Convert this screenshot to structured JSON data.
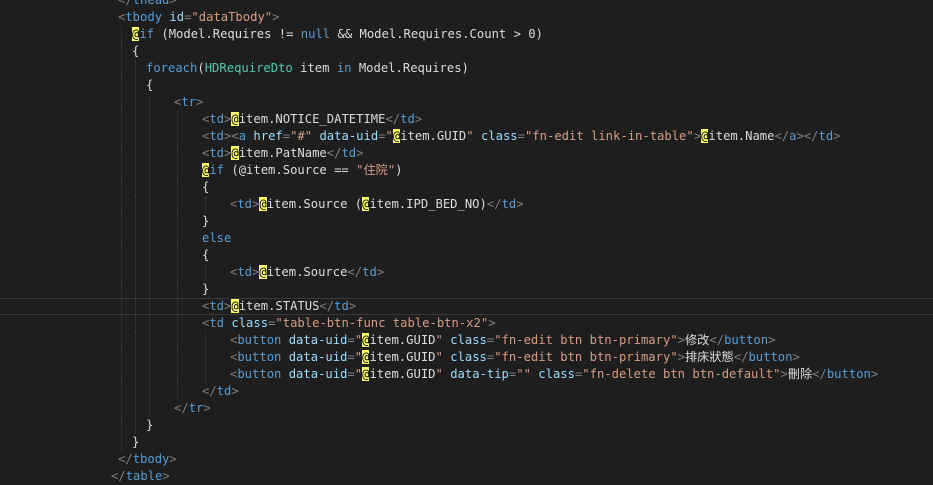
{
  "theme": {
    "background": "#1e1e1e",
    "punctuation": "#808080",
    "tag": "#569cd6",
    "attribute": "#9cdcfe",
    "string": "#d69d85",
    "text": "#dcdcdc",
    "razor_marker_bg": "#ffff66",
    "type": "#4ec9b0"
  },
  "editor": {
    "lines": [
      {
        "indent": 4,
        "tokens": [
          {
            "t": "pun",
            "v": "</"
          },
          {
            "t": "tag",
            "v": "thead"
          },
          {
            "t": "pun",
            "v": ">"
          }
        ]
      },
      {
        "indent": 4,
        "tokens": [
          {
            "t": "pun",
            "v": "<"
          },
          {
            "t": "tag",
            "v": "tbody"
          },
          {
            "t": "txt",
            "v": " "
          },
          {
            "t": "attr",
            "v": "id"
          },
          {
            "t": "pun",
            "v": "="
          },
          {
            "t": "str",
            "v": "\"dataTbody\""
          },
          {
            "t": "pun",
            "v": ">"
          }
        ]
      },
      {
        "indent": 6,
        "tokens": [
          {
            "t": "razor",
            "v": "@"
          },
          {
            "t": "kw",
            "v": "if"
          },
          {
            "t": "id",
            "v": " (Model.Requires != "
          },
          {
            "t": "kw",
            "v": "null"
          },
          {
            "t": "id",
            "v": " && Model.Requires.Count > 0)"
          }
        ]
      },
      {
        "indent": 6,
        "tokens": [
          {
            "t": "id",
            "v": "{"
          }
        ]
      },
      {
        "indent": 8,
        "tokens": [
          {
            "t": "kw",
            "v": "foreach"
          },
          {
            "t": "id",
            "v": "("
          },
          {
            "t": "type",
            "v": "HDRequireDto"
          },
          {
            "t": "id",
            "v": " item "
          },
          {
            "t": "kw",
            "v": "in"
          },
          {
            "t": "id",
            "v": " Model.Requires)"
          }
        ]
      },
      {
        "indent": 8,
        "tokens": [
          {
            "t": "id",
            "v": "{"
          }
        ]
      },
      {
        "indent": 12,
        "tokens": [
          {
            "t": "pun",
            "v": "<"
          },
          {
            "t": "tag",
            "v": "tr"
          },
          {
            "t": "pun",
            "v": ">"
          }
        ]
      },
      {
        "indent": 16,
        "tokens": [
          {
            "t": "pun",
            "v": "<"
          },
          {
            "t": "tag",
            "v": "td"
          },
          {
            "t": "pun",
            "v": ">"
          },
          {
            "t": "razor",
            "v": "@"
          },
          {
            "t": "id",
            "v": "item.NOTICE_DATETIME"
          },
          {
            "t": "pun",
            "v": "</"
          },
          {
            "t": "tag",
            "v": "td"
          },
          {
            "t": "pun",
            "v": ">"
          }
        ]
      },
      {
        "indent": 16,
        "tokens": [
          {
            "t": "pun",
            "v": "<"
          },
          {
            "t": "tag",
            "v": "td"
          },
          {
            "t": "pun",
            "v": "><"
          },
          {
            "t": "tag",
            "v": "a"
          },
          {
            "t": "txt",
            "v": " "
          },
          {
            "t": "attr",
            "v": "href"
          },
          {
            "t": "pun",
            "v": "="
          },
          {
            "t": "str",
            "v": "\"#\""
          },
          {
            "t": "txt",
            "v": " "
          },
          {
            "t": "attr",
            "v": "data-uid"
          },
          {
            "t": "pun",
            "v": "="
          },
          {
            "t": "str",
            "v": "\""
          },
          {
            "t": "razor",
            "v": "@"
          },
          {
            "t": "id",
            "v": "item.GUID"
          },
          {
            "t": "str",
            "v": "\""
          },
          {
            "t": "txt",
            "v": " "
          },
          {
            "t": "attr",
            "v": "class"
          },
          {
            "t": "pun",
            "v": "="
          },
          {
            "t": "str",
            "v": "\"fn-edit link-in-table\""
          },
          {
            "t": "pun",
            "v": ">"
          },
          {
            "t": "razor",
            "v": "@"
          },
          {
            "t": "id",
            "v": "item.Name"
          },
          {
            "t": "pun",
            "v": "</"
          },
          {
            "t": "tag",
            "v": "a"
          },
          {
            "t": "pun",
            "v": "></"
          },
          {
            "t": "tag",
            "v": "td"
          },
          {
            "t": "pun",
            "v": ">"
          }
        ]
      },
      {
        "indent": 16,
        "tokens": [
          {
            "t": "pun",
            "v": "<"
          },
          {
            "t": "tag",
            "v": "td"
          },
          {
            "t": "pun",
            "v": ">"
          },
          {
            "t": "razor",
            "v": "@"
          },
          {
            "t": "id",
            "v": "item.PatName"
          },
          {
            "t": "pun",
            "v": "</"
          },
          {
            "t": "tag",
            "v": "td"
          },
          {
            "t": "pun",
            "v": ">"
          }
        ]
      },
      {
        "indent": 16,
        "tokens": [
          {
            "t": "razor",
            "v": "@"
          },
          {
            "t": "kw",
            "v": "if"
          },
          {
            "t": "id",
            "v": " (@item.Source == "
          },
          {
            "t": "str",
            "v": "\"住院\""
          },
          {
            "t": "id",
            "v": ")"
          }
        ]
      },
      {
        "indent": 16,
        "tokens": [
          {
            "t": "id",
            "v": "{"
          }
        ]
      },
      {
        "indent": 20,
        "tokens": [
          {
            "t": "pun",
            "v": "<"
          },
          {
            "t": "tag",
            "v": "td"
          },
          {
            "t": "pun",
            "v": ">"
          },
          {
            "t": "razor",
            "v": "@"
          },
          {
            "t": "id",
            "v": "item.Source ("
          },
          {
            "t": "razor",
            "v": "@"
          },
          {
            "t": "id",
            "v": "item.IPD_BED_NO)"
          },
          {
            "t": "pun",
            "v": "</"
          },
          {
            "t": "tag",
            "v": "td"
          },
          {
            "t": "pun",
            "v": ">"
          }
        ]
      },
      {
        "indent": 16,
        "tokens": [
          {
            "t": "id",
            "v": "}"
          }
        ]
      },
      {
        "indent": 16,
        "tokens": [
          {
            "t": "kw",
            "v": "else"
          }
        ]
      },
      {
        "indent": 16,
        "tokens": [
          {
            "t": "id",
            "v": "{"
          }
        ]
      },
      {
        "indent": 20,
        "tokens": [
          {
            "t": "pun",
            "v": "<"
          },
          {
            "t": "tag",
            "v": "td"
          },
          {
            "t": "pun",
            "v": ">"
          },
          {
            "t": "razor",
            "v": "@"
          },
          {
            "t": "id",
            "v": "item.Source"
          },
          {
            "t": "pun",
            "v": "</"
          },
          {
            "t": "tag",
            "v": "td"
          },
          {
            "t": "pun",
            "v": ">"
          }
        ]
      },
      {
        "indent": 16,
        "tokens": [
          {
            "t": "id",
            "v": "}"
          }
        ]
      },
      {
        "indent": 16,
        "current": true,
        "tokens": [
          {
            "t": "pun",
            "v": "<"
          },
          {
            "t": "tag",
            "v": "td"
          },
          {
            "t": "pun",
            "v": ">"
          },
          {
            "t": "razor",
            "v": "@"
          },
          {
            "t": "id",
            "v": "item.STATUS"
          },
          {
            "t": "pun",
            "v": "</"
          },
          {
            "t": "tag",
            "v": "td"
          },
          {
            "t": "pun",
            "v": ">"
          }
        ]
      },
      {
        "indent": 16,
        "tokens": [
          {
            "t": "pun",
            "v": "<"
          },
          {
            "t": "tag",
            "v": "td"
          },
          {
            "t": "txt",
            "v": " "
          },
          {
            "t": "attr",
            "v": "class"
          },
          {
            "t": "pun",
            "v": "="
          },
          {
            "t": "str",
            "v": "\"table-btn-func table-btn-x2\""
          },
          {
            "t": "pun",
            "v": ">"
          }
        ]
      },
      {
        "indent": 20,
        "tokens": [
          {
            "t": "pun",
            "v": "<"
          },
          {
            "t": "tag",
            "v": "button"
          },
          {
            "t": "txt",
            "v": " "
          },
          {
            "t": "attr",
            "v": "data-uid"
          },
          {
            "t": "pun",
            "v": "="
          },
          {
            "t": "str",
            "v": "\""
          },
          {
            "t": "razor",
            "v": "@"
          },
          {
            "t": "id",
            "v": "item.GUID"
          },
          {
            "t": "str",
            "v": "\""
          },
          {
            "t": "txt",
            "v": " "
          },
          {
            "t": "attr",
            "v": "class"
          },
          {
            "t": "pun",
            "v": "="
          },
          {
            "t": "str",
            "v": "\"fn-edit btn btn-primary\""
          },
          {
            "t": "pun",
            "v": ">"
          },
          {
            "t": "txt",
            "v": "修改"
          },
          {
            "t": "pun",
            "v": "</"
          },
          {
            "t": "tag",
            "v": "button"
          },
          {
            "t": "pun",
            "v": ">"
          }
        ]
      },
      {
        "indent": 20,
        "tokens": [
          {
            "t": "pun",
            "v": "<"
          },
          {
            "t": "tag",
            "v": "button"
          },
          {
            "t": "txt",
            "v": " "
          },
          {
            "t": "attr",
            "v": "data-uid"
          },
          {
            "t": "pun",
            "v": "="
          },
          {
            "t": "str",
            "v": "\""
          },
          {
            "t": "razor",
            "v": "@"
          },
          {
            "t": "id",
            "v": "item.GUID"
          },
          {
            "t": "str",
            "v": "\""
          },
          {
            "t": "txt",
            "v": " "
          },
          {
            "t": "attr",
            "v": "class"
          },
          {
            "t": "pun",
            "v": "="
          },
          {
            "t": "str",
            "v": "\"fn-edit btn btn-primary\""
          },
          {
            "t": "pun",
            "v": ">"
          },
          {
            "t": "txt",
            "v": "排床狀態"
          },
          {
            "t": "pun",
            "v": "</"
          },
          {
            "t": "tag",
            "v": "button"
          },
          {
            "t": "pun",
            "v": ">"
          }
        ]
      },
      {
        "indent": 20,
        "tokens": [
          {
            "t": "pun",
            "v": "<"
          },
          {
            "t": "tag",
            "v": "button"
          },
          {
            "t": "txt",
            "v": " "
          },
          {
            "t": "attr",
            "v": "data-uid"
          },
          {
            "t": "pun",
            "v": "="
          },
          {
            "t": "str",
            "v": "\""
          },
          {
            "t": "razor",
            "v": "@"
          },
          {
            "t": "id",
            "v": "item.GUID"
          },
          {
            "t": "str",
            "v": "\""
          },
          {
            "t": "txt",
            "v": " "
          },
          {
            "t": "attr",
            "v": "data-tip"
          },
          {
            "t": "pun",
            "v": "="
          },
          {
            "t": "str",
            "v": "\"\""
          },
          {
            "t": "txt",
            "v": " "
          },
          {
            "t": "attr",
            "v": "class"
          },
          {
            "t": "pun",
            "v": "="
          },
          {
            "t": "str",
            "v": "\"fn-delete btn btn-default\""
          },
          {
            "t": "pun",
            "v": ">"
          },
          {
            "t": "txt",
            "v": "刪除"
          },
          {
            "t": "pun",
            "v": "</"
          },
          {
            "t": "tag",
            "v": "button"
          },
          {
            "t": "pun",
            "v": ">"
          }
        ]
      },
      {
        "indent": 16,
        "tokens": [
          {
            "t": "pun",
            "v": "</"
          },
          {
            "t": "tag",
            "v": "td"
          },
          {
            "t": "pun",
            "v": ">"
          }
        ]
      },
      {
        "indent": 12,
        "tokens": [
          {
            "t": "pun",
            "v": "</"
          },
          {
            "t": "tag",
            "v": "tr"
          },
          {
            "t": "pun",
            "v": ">"
          }
        ]
      },
      {
        "indent": 8,
        "tokens": [
          {
            "t": "id",
            "v": "}"
          }
        ]
      },
      {
        "indent": 6,
        "tokens": [
          {
            "t": "id",
            "v": "}"
          }
        ]
      },
      {
        "indent": 4,
        "tokens": [
          {
            "t": "pun",
            "v": "</"
          },
          {
            "t": "tag",
            "v": "tbody"
          },
          {
            "t": "pun",
            "v": ">"
          }
        ]
      },
      {
        "indent": 3,
        "tokens": [
          {
            "t": "pun",
            "v": "</"
          },
          {
            "t": "tag",
            "v": "table"
          },
          {
            "t": "pun",
            "v": ">"
          }
        ]
      }
    ]
  }
}
